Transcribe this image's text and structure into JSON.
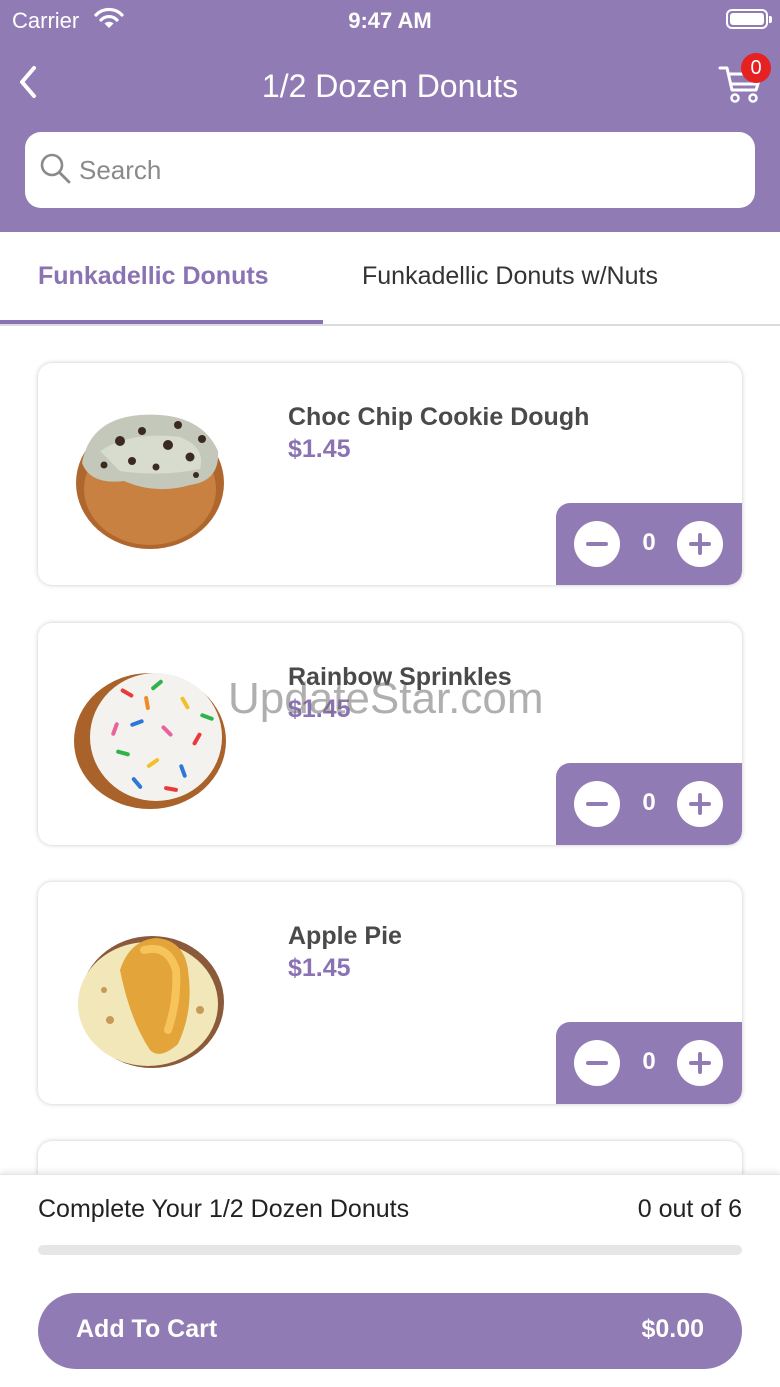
{
  "status_bar": {
    "carrier": "Carrier",
    "time": "9:47 AM"
  },
  "nav": {
    "title": "1/2 Dozen Donuts",
    "cart_count": "0"
  },
  "search": {
    "placeholder": "Search"
  },
  "tabs": [
    {
      "label": "Funkadellic Donuts",
      "selected": true
    },
    {
      "label": "Funkadellic Donuts w/Nuts",
      "selected": false
    }
  ],
  "products": [
    {
      "name": "Choc Chip Cookie Dough",
      "price": "$1.45",
      "quantity": "0"
    },
    {
      "name": "Rainbow Sprinkles",
      "price": "$1.45",
      "quantity": "0"
    },
    {
      "name": "Apple Pie",
      "price": "$1.45",
      "quantity": "0"
    }
  ],
  "watermark": "UpdateStar.com",
  "footer": {
    "label": "Complete Your 1/2 Dozen Donuts",
    "count": "0 out of 6",
    "progress": 0,
    "button_label": "Add To Cart",
    "total": "$0.00"
  },
  "colors": {
    "accent": "#917bb4",
    "accent_text": "#8a72b3",
    "badge": "#e52121"
  }
}
